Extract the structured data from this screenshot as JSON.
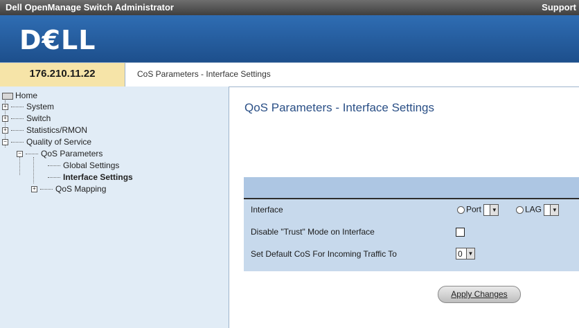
{
  "window": {
    "app_title": "Dell OpenManage Switch Administrator",
    "support_link": "Support"
  },
  "banner": {
    "logo_text": "D€LL"
  },
  "header": {
    "ip_address": "176.210.11.22",
    "breadcrumb": "CoS Parameters - Interface Settings"
  },
  "tree": {
    "home": "Home",
    "system": "System",
    "switch": "Switch",
    "statistics": "Statistics/RMON",
    "qos": "Quality of Service",
    "qos_parameters": "QoS Parameters",
    "global_settings": "Global Settings",
    "interface_settings": "Interface Settings",
    "qos_mapping": "QoS Mapping"
  },
  "main": {
    "page_title": "QoS Parameters - Interface Settings",
    "interface_label": "Interface",
    "port_label": "Port",
    "lag_label": "LAG",
    "disable_trust_label": "Disable \"Trust\" Mode on Interface",
    "default_cos_label": "Set Default CoS For Incoming Traffic To",
    "default_cos_value": "0",
    "apply_button": "Apply Changes"
  }
}
